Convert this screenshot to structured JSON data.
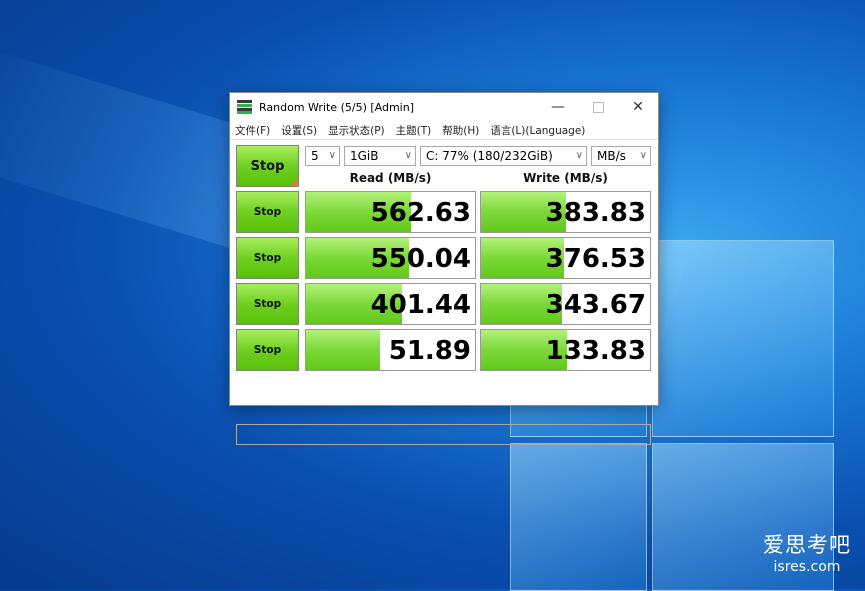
{
  "window": {
    "title": "Random Write (5/5) [Admin]"
  },
  "menu": [
    "文件(F)",
    "设置(S)",
    "显示状态(P)",
    "主题(T)",
    "帮助(H)",
    "语言(L)(Language)"
  ],
  "controls": {
    "all_button": "Stop",
    "count": "5",
    "size": "1GiB",
    "drive": "C: 77% (180/232GiB)",
    "unit": "MB/s"
  },
  "headers": {
    "read": "Read (MB/s)",
    "write": "Write (MB/s)"
  },
  "rows": [
    {
      "button": "Stop",
      "read": "562.63",
      "write": "383.83",
      "read_fill": 0.62,
      "write_fill": 0.5
    },
    {
      "button": "Stop",
      "read": "550.04",
      "write": "376.53",
      "read_fill": 0.61,
      "write_fill": 0.49
    },
    {
      "button": "Stop",
      "read": "401.44",
      "write": "343.67",
      "read_fill": 0.57,
      "write_fill": 0.48
    },
    {
      "button": "Stop",
      "read": "51.89",
      "write": "133.83",
      "read_fill": 0.44,
      "write_fill": 0.51
    }
  ],
  "status": "",
  "watermark": {
    "logo": "爱思考吧",
    "url": "isres.com"
  }
}
